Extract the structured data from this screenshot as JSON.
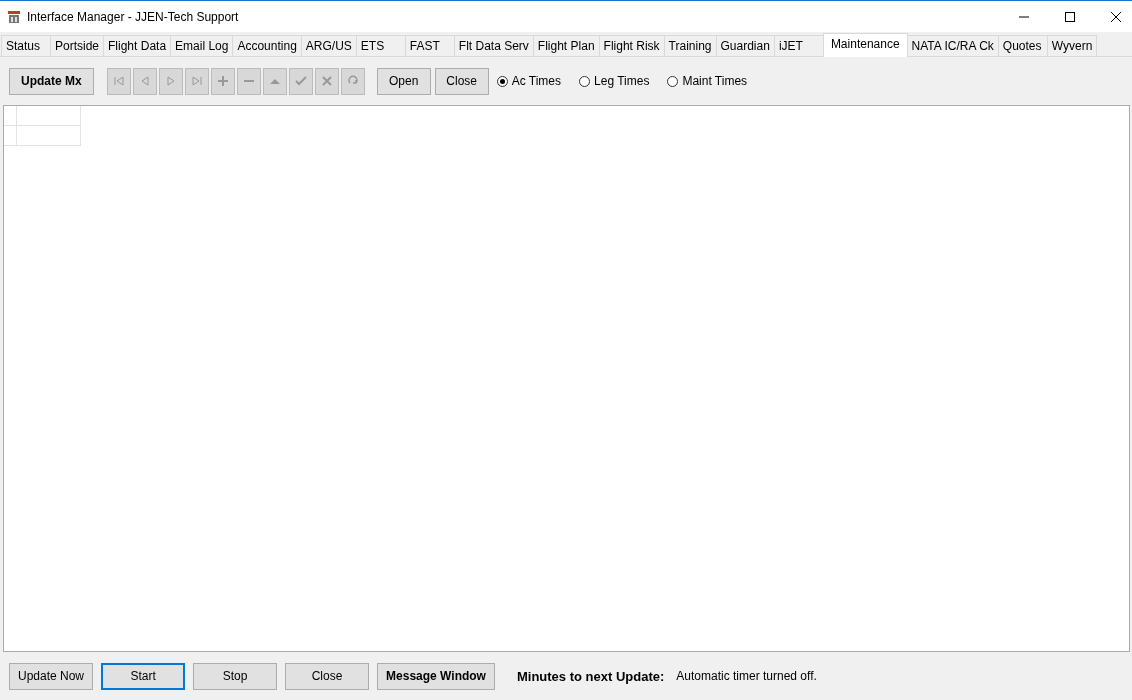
{
  "window": {
    "title": "Interface Manager - JJEN-Tech Support"
  },
  "tabs": [
    {
      "label": "Status",
      "selected": false
    },
    {
      "label": "Portside",
      "selected": false
    },
    {
      "label": "Flight Data",
      "selected": false
    },
    {
      "label": "Email Log",
      "selected": false
    },
    {
      "label": "Accounting",
      "selected": false
    },
    {
      "label": "ARG/US",
      "selected": false
    },
    {
      "label": "ETS",
      "selected": false
    },
    {
      "label": "FAST",
      "selected": false
    },
    {
      "label": "Flt Data Serv",
      "selected": false
    },
    {
      "label": "Flight Plan",
      "selected": false
    },
    {
      "label": "Flight Risk",
      "selected": false
    },
    {
      "label": "Training",
      "selected": false
    },
    {
      "label": "Guardian",
      "selected": false
    },
    {
      "label": "iJET",
      "selected": false
    },
    {
      "label": "Maintenance",
      "selected": true
    },
    {
      "label": "NATA IC/RA Ck",
      "selected": false
    },
    {
      "label": "Quotes",
      "selected": false
    },
    {
      "label": "Wyvern",
      "selected": false
    }
  ],
  "toolbar": {
    "update_button": "Update Mx",
    "navigator": [
      {
        "kind": "first",
        "disabled": true
      },
      {
        "kind": "prev",
        "disabled": true
      },
      {
        "kind": "next",
        "disabled": true
      },
      {
        "kind": "last",
        "disabled": true
      },
      {
        "kind": "add",
        "disabled": true
      },
      {
        "kind": "remove",
        "disabled": true
      },
      {
        "kind": "up",
        "disabled": true
      },
      {
        "kind": "check",
        "disabled": true
      },
      {
        "kind": "cancel",
        "disabled": true
      },
      {
        "kind": "refresh",
        "disabled": true
      }
    ],
    "buttons": [
      "Open",
      "Close"
    ],
    "radios": [
      {
        "label": "Ac Times",
        "selected": true
      },
      {
        "label": "Leg Times",
        "selected": false
      },
      {
        "label": "Maint Times",
        "selected": false
      }
    ]
  },
  "bottom_bar": {
    "buttons": [
      {
        "label": "Update Now",
        "bold": false,
        "focused": false
      },
      {
        "label": "Start",
        "bold": false,
        "focused": true
      },
      {
        "label": "Stop",
        "bold": false,
        "focused": false
      },
      {
        "label": "Close",
        "bold": false,
        "focused": false
      },
      {
        "label": "Message Window",
        "bold": true,
        "focused": false
      }
    ],
    "timer_label": "Minutes to next Update:",
    "timer_status": "Automatic timer turned off."
  }
}
